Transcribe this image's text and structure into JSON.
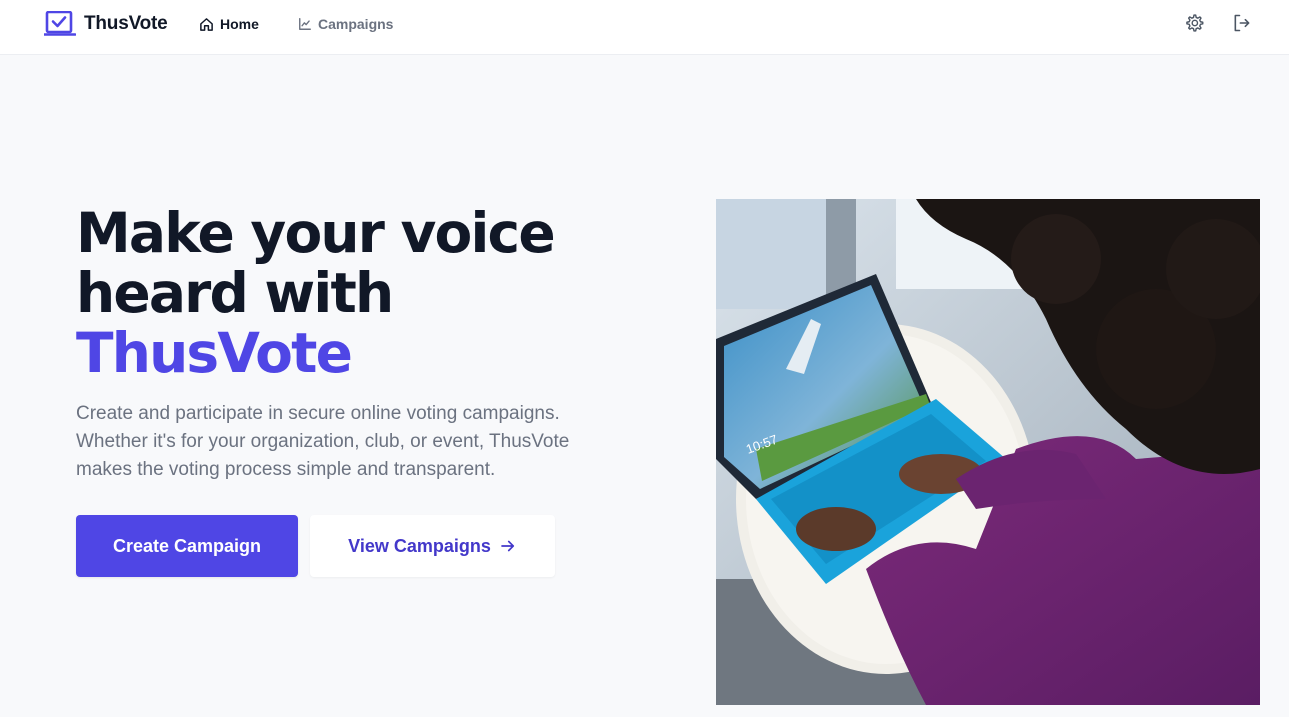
{
  "nav": {
    "brand": "ThusVote",
    "links": [
      {
        "label": "Home",
        "icon": "home-icon",
        "active": true
      },
      {
        "label": "Campaigns",
        "icon": "chart-icon",
        "active": false
      }
    ],
    "right_icons": [
      "gear-icon",
      "logout-icon"
    ]
  },
  "hero": {
    "title_line1": "Make your voice",
    "title_line2": "heard with",
    "title_accent": "ThusVote",
    "description": "Create and participate in secure online voting campaigns. Whether it's for your organization, club, or event, ThusVote makes the voting process simple and transparent.",
    "primary_button": "Create Campaign",
    "secondary_button": "View Campaigns",
    "secondary_icon": "arrow-right-icon",
    "image_icon": "laptop-photo"
  },
  "colors": {
    "accent": "#4f46e5",
    "accent_dark": "#4338ca",
    "text_dark": "#111827",
    "text_muted": "#6b7280",
    "background": "#f8f9fb"
  }
}
